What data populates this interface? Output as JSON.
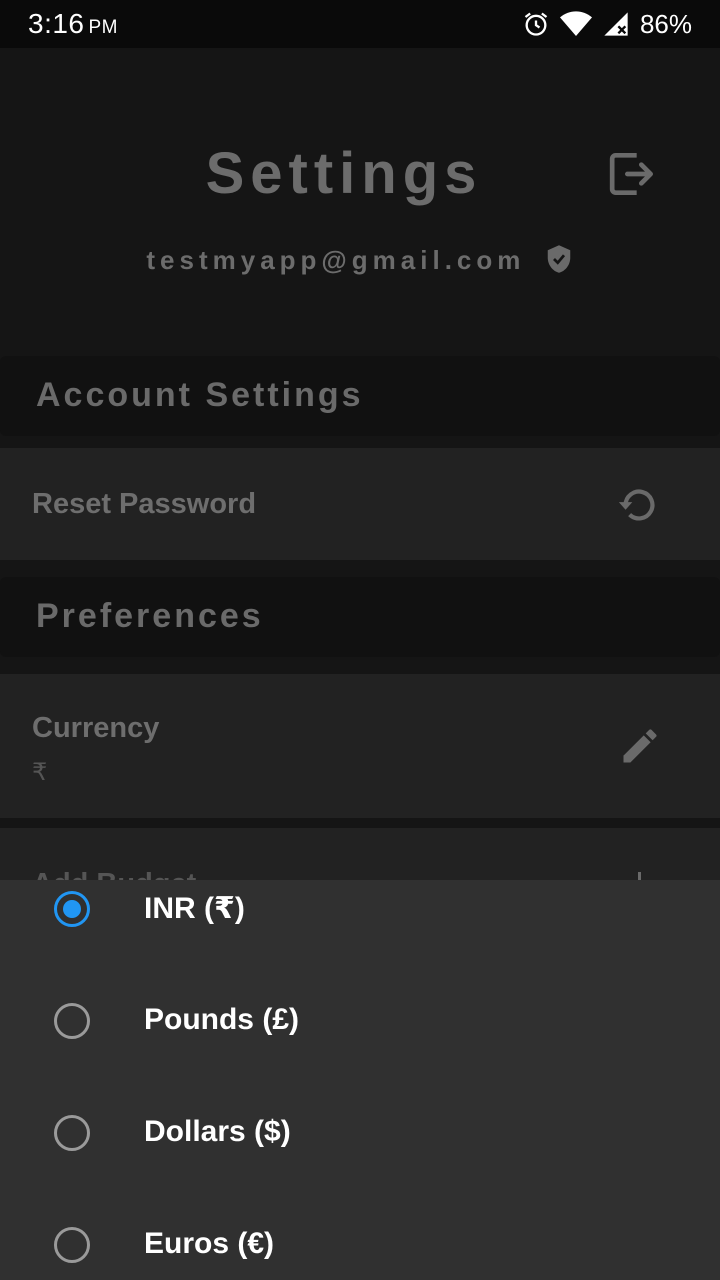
{
  "status_bar": {
    "time": "3:16",
    "ampm": "PM",
    "battery": "86%"
  },
  "header": {
    "title": "Settings",
    "email": "testmyapp@gmail.com"
  },
  "sections": {
    "account": {
      "title": "Account Settings"
    },
    "preferences": {
      "title": "Preferences"
    }
  },
  "items": {
    "reset_password": {
      "label": "Reset Password"
    },
    "currency": {
      "label": "Currency",
      "value": "₹"
    },
    "partial": {
      "label": "Add Budget"
    }
  },
  "currency_options": [
    {
      "label": "INR (₹)",
      "selected": true
    },
    {
      "label": "Pounds (£)",
      "selected": false
    },
    {
      "label": "Dollars ($)",
      "selected": false
    },
    {
      "label": "Euros (€)",
      "selected": false
    }
  ],
  "colors": {
    "accent": "#2196f3",
    "sheet_bg": "#303030",
    "card_bg": "#222222",
    "section_bg": "#111111"
  }
}
